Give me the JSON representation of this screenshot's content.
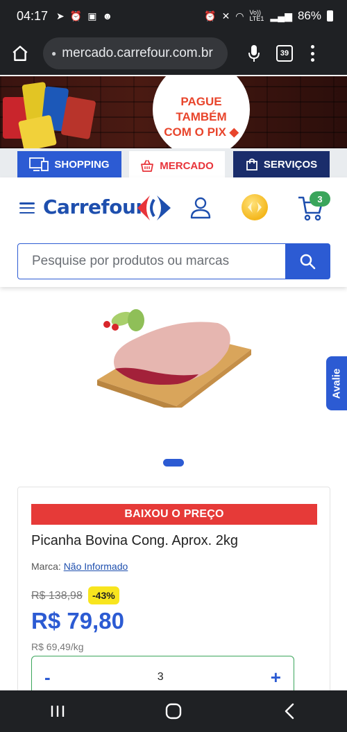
{
  "status_bar": {
    "time": "04:17",
    "battery": "86%",
    "network_label": "Vo)) LTE1"
  },
  "browser": {
    "url": "mercado.carrefour.com.br",
    "tab_count": "39"
  },
  "banner": {
    "line1": "PAGUE",
    "line2": "TAMBÉM",
    "line3": "COM O PIX"
  },
  "nav_tabs": {
    "shopping": "SHOPPING",
    "mercado": "MERCADO",
    "servicos": "SERVIÇOS"
  },
  "header": {
    "logo": "Carrefour",
    "cart_count": "3"
  },
  "search": {
    "placeholder": "Pesquise por produtos ou marcas"
  },
  "feedback_tab": "Avalie",
  "product": {
    "promo_banner": "BAIXOU O PREÇO",
    "title": "Picanha Bovina Cong. Aprox. 2kg",
    "brand_label": "Marca:",
    "brand_value": "Não Informado",
    "old_price": "R$ 138,98",
    "discount": "-43%",
    "price": "R$ 79,80",
    "unit_price": "R$ 69,49/kg",
    "quantity": "3",
    "minus_label": "-",
    "plus_label": "+"
  },
  "colors": {
    "brand_blue": "#2c5bd3",
    "promo_red": "#e63a38",
    "discount_yellow": "#f8e51e",
    "qty_green": "#3aa55b"
  }
}
